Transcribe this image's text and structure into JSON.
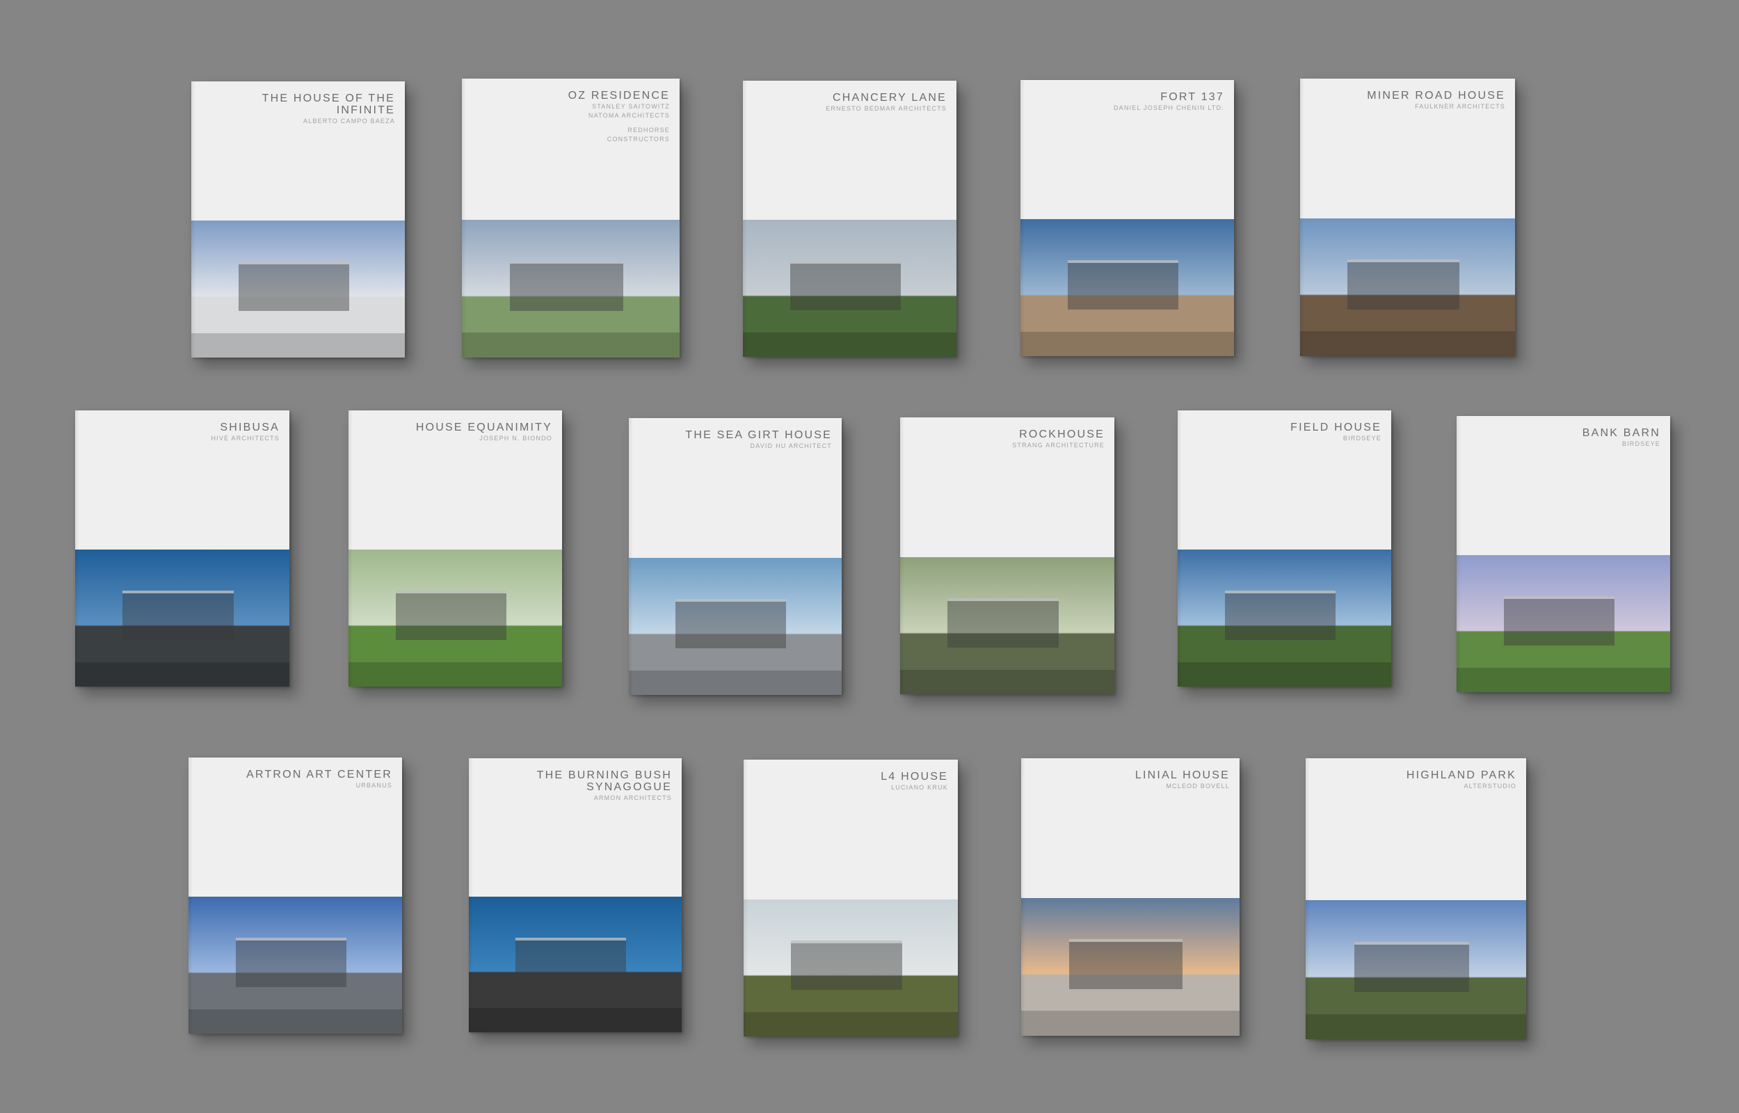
{
  "books": [
    {
      "title": "THE HOUSE OF THE INFINITE",
      "subtitle": [
        "ALBERTO CAMPO BAEZA"
      ],
      "sky": [
        "#7f9cc6",
        "#dfe3ea"
      ],
      "ground": "#d9dbdd"
    },
    {
      "title": "OZ RESIDENCE",
      "subtitle": [
        "STANLEY SAITOWITZ",
        "NATOMA ARCHITECTS",
        "",
        "REDHORSE",
        "CONSTRUCTORS"
      ],
      "sky": [
        "#8fa4bd",
        "#d4d9df"
      ],
      "ground": "#7f9b6a"
    },
    {
      "title": "CHANCERY LANE",
      "subtitle": [
        "ERNESTO BEDMAR ARCHITECTS"
      ],
      "sky": [
        "#a9b6c2",
        "#c6cdd2"
      ],
      "ground": "#4c6b3a"
    },
    {
      "title": "FORT 137",
      "subtitle": [
        "DANIEL JOSEPH CHENIN LTD."
      ],
      "sky": [
        "#3f6ea3",
        "#9bb6d1"
      ],
      "ground": "#a98f74"
    },
    {
      "title": "MINER ROAD HOUSE",
      "subtitle": [
        "FAULKNER ARCHITECTS"
      ],
      "sky": [
        "#6f95c0",
        "#b8c9da"
      ],
      "ground": "#6f5a46"
    },
    {
      "title": "SHIBUSA",
      "subtitle": [
        "HIVE ARCHITECTS"
      ],
      "sky": [
        "#1f5f99",
        "#5b8fc0"
      ],
      "ground": "#3a3f42"
    },
    {
      "title": "HOUSE EQUANIMITY",
      "subtitle": [
        "JOSEPH N. BIONDO"
      ],
      "sky": [
        "#9fb88d",
        "#cfdcc4"
      ],
      "ground": "#5c8d3d"
    },
    {
      "title": "THE SEA GIRT HOUSE",
      "subtitle": [
        "DAVID HU ARCHITECT"
      ],
      "sky": [
        "#6d9cc4",
        "#c2d6e6"
      ],
      "ground": "#8e9296"
    },
    {
      "title": "ROCKHOUSE",
      "subtitle": [
        "STRANG ARCHITECTURE"
      ],
      "sky": [
        "#8da07a",
        "#c9d2b8"
      ],
      "ground": "#5f6a4c"
    },
    {
      "title": "FIELD HOUSE",
      "subtitle": [
        "BIRDSEYE"
      ],
      "sky": [
        "#3c6fa6",
        "#9fbfdc"
      ],
      "ground": "#4a6b35"
    },
    {
      "title": "BANK BARN",
      "subtitle": [
        "BIRDSEYE"
      ],
      "sky": [
        "#8f9ccc",
        "#cfc7dc"
      ],
      "ground": "#5f8b42"
    },
    {
      "title": "ARTRON ART CENTER",
      "subtitle": [
        "URBANUS"
      ],
      "sky": [
        "#3d6bb0",
        "#9ab7df"
      ],
      "ground": "#6c7278"
    },
    {
      "title": "THE BURNING BUSH SYNAGOGUE",
      "subtitle": [
        "ARMON ARCHITECTS"
      ],
      "sky": [
        "#1c5f98",
        "#3a83bd"
      ],
      "ground": "#3a3a3a"
    },
    {
      "title": "L4 HOUSE",
      "subtitle": [
        "LUCIANO KRUK"
      ],
      "sky": [
        "#c9d3d8",
        "#e3e6e6"
      ],
      "ground": "#5f6a3c"
    },
    {
      "title": "LINIAL HOUSE",
      "subtitle": [
        "MCLEOD BOVELL"
      ],
      "sky": [
        "#5f7b9e",
        "#e7b98c"
      ],
      "ground": "#b9b3ab"
    },
    {
      "title": "HIGHLAND PARK",
      "subtitle": [
        "ALTERSTUDIO"
      ],
      "sky": [
        "#5f86bf",
        "#c1d1e5"
      ],
      "ground": "#55683e"
    }
  ]
}
